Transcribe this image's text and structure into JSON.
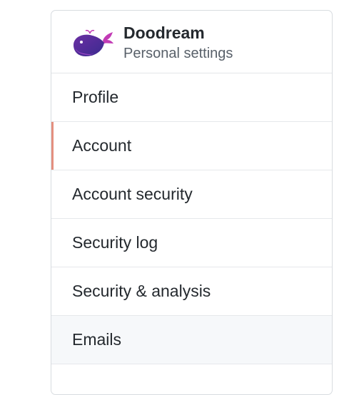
{
  "account": {
    "name": "Doodream",
    "subtitle": "Personal settings",
    "avatar_icon": "whale-icon"
  },
  "nav": {
    "items": [
      {
        "label": "Profile"
      },
      {
        "label": "Account",
        "selected": true
      },
      {
        "label": "Account security"
      },
      {
        "label": "Security log"
      },
      {
        "label": "Security & analysis"
      },
      {
        "label": "Emails",
        "hovered": true
      }
    ]
  },
  "colors": {
    "selected_indicator": "#e48f7f",
    "hover_background": "#f6f8fa",
    "whale_primary": "#6b2fa3",
    "whale_secondary": "#c23bb5"
  }
}
